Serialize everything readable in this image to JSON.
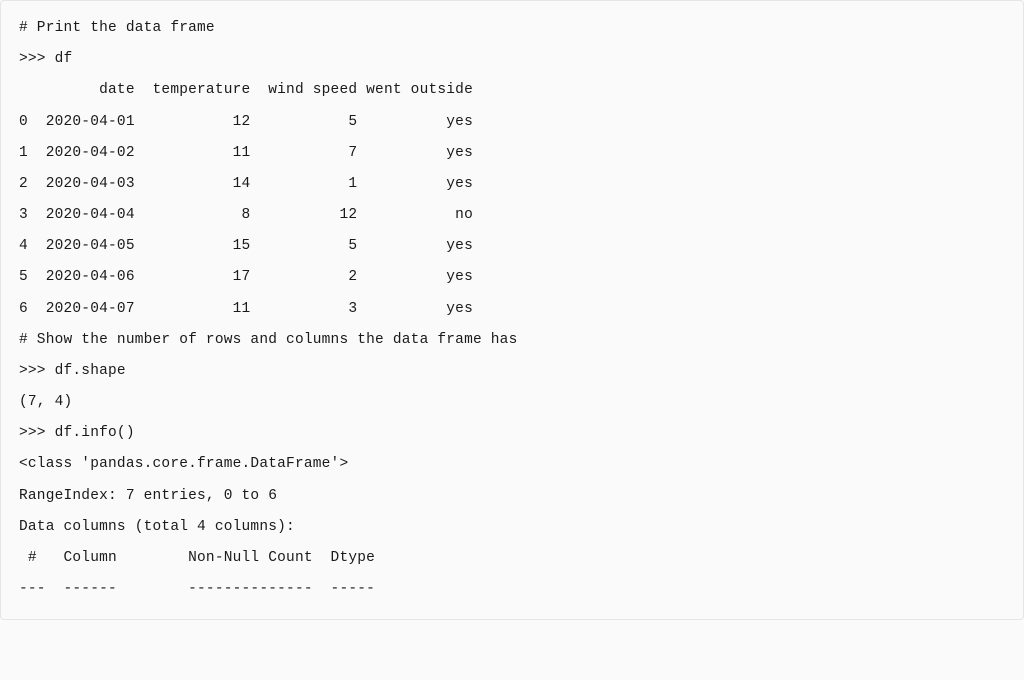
{
  "lines": [
    "# Print the data frame",
    ">>> df",
    "         date  temperature  wind speed went outside",
    "0  2020-04-01           12           5          yes",
    "1  2020-04-02           11           7          yes",
    "2  2020-04-03           14           1          yes",
    "3  2020-04-04            8          12           no",
    "4  2020-04-05           15           5          yes",
    "5  2020-04-06           17           2          yes",
    "6  2020-04-07           11           3          yes",
    "# Show the number of rows and columns the data frame has",
    ">>> df.shape",
    "(7, 4)",
    ">>> df.info()",
    "<class 'pandas.core.frame.DataFrame'>",
    "RangeIndex: 7 entries, 0 to 6",
    "Data columns (total 4 columns):",
    " #   Column        Non-Null Count  Dtype",
    "---  ------        --------------  -----"
  ],
  "chart_data": {
    "type": "table",
    "dataframe": {
      "columns": [
        "date",
        "temperature",
        "wind speed",
        "went outside"
      ],
      "index": [
        0,
        1,
        2,
        3,
        4,
        5,
        6
      ],
      "rows": [
        [
          "2020-04-01",
          12,
          5,
          "yes"
        ],
        [
          "2020-04-02",
          11,
          7,
          "yes"
        ],
        [
          "2020-04-03",
          14,
          1,
          "yes"
        ],
        [
          "2020-04-04",
          8,
          12,
          "no"
        ],
        [
          "2020-04-05",
          15,
          5,
          "yes"
        ],
        [
          "2020-04-06",
          17,
          2,
          "yes"
        ],
        [
          "2020-04-07",
          11,
          3,
          "yes"
        ]
      ]
    },
    "shape": [
      7,
      4
    ],
    "info": {
      "class": "pandas.core.frame.DataFrame",
      "range_index": "7 entries, 0 to 6",
      "total_columns": 4
    }
  }
}
